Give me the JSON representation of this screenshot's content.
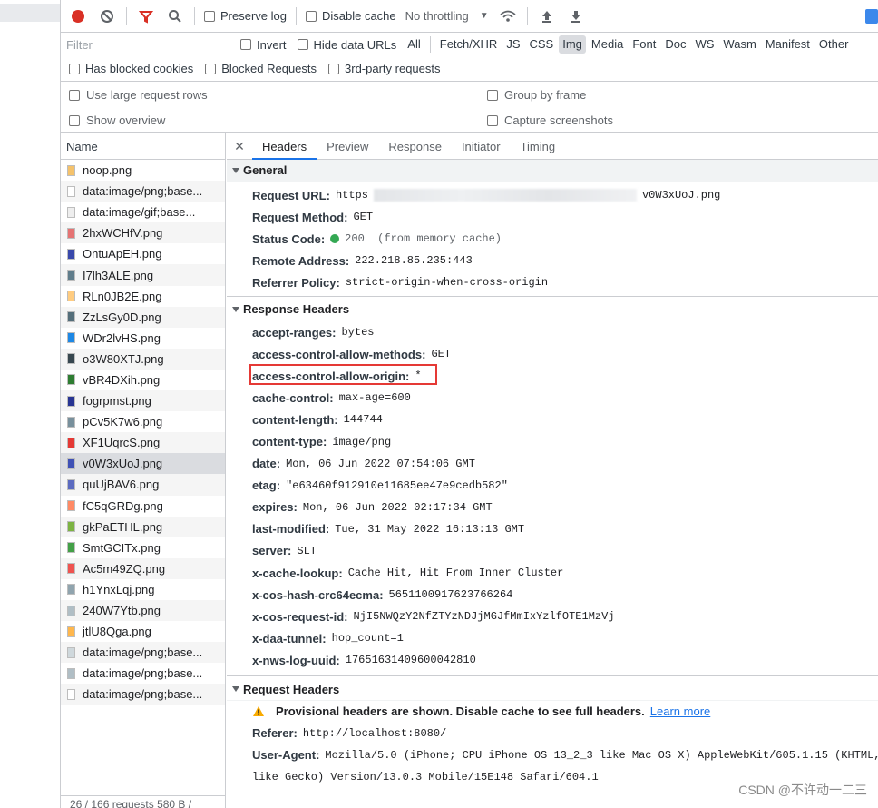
{
  "toolbar": {
    "preserve_log": "Preserve log",
    "disable_cache": "Disable cache",
    "throttling": "No throttling"
  },
  "filter": {
    "placeholder": "Filter",
    "invert": "Invert",
    "hide_data_urls": "Hide data URLs",
    "types": [
      "All",
      "Fetch/XHR",
      "JS",
      "CSS",
      "Img",
      "Media",
      "Font",
      "Doc",
      "WS",
      "Wasm",
      "Manifest",
      "Other"
    ],
    "active_type": "Img",
    "has_blocked_cookies": "Has blocked cookies",
    "blocked_requests": "Blocked Requests",
    "third_party": "3rd-party requests"
  },
  "settings": {
    "large_rows": "Use large request rows",
    "group_by_frame": "Group by frame",
    "show_overview": "Show overview",
    "capture_screenshots": "Capture screenshots"
  },
  "request_list": {
    "header": "Name",
    "items": [
      {
        "name": "noop.png",
        "color": "#f5c26b"
      },
      {
        "name": "data:image/png;base...",
        "color": "#ffffff"
      },
      {
        "name": "data:image/gif;base...",
        "color": "#eeeeee"
      },
      {
        "name": "2hxWCHfV.png",
        "color": "#e57373"
      },
      {
        "name": "OntuApEH.png",
        "color": "#3949ab"
      },
      {
        "name": "I7lh3ALE.png",
        "color": "#607d8b"
      },
      {
        "name": "RLn0JB2E.png",
        "color": "#ffcc80"
      },
      {
        "name": "ZzLsGy0D.png",
        "color": "#546e7a"
      },
      {
        "name": "WDr2lvHS.png",
        "color": "#1e88e5"
      },
      {
        "name": "o3W80XTJ.png",
        "color": "#37474f"
      },
      {
        "name": "vBR4DXih.png",
        "color": "#2e7d32"
      },
      {
        "name": "fogrpmst.png",
        "color": "#283593"
      },
      {
        "name": "pCv5K7w6.png",
        "color": "#78909c"
      },
      {
        "name": "XF1UqrcS.png",
        "color": "#e53935"
      },
      {
        "name": "v0W3xUoJ.png",
        "color": "#3f51b5"
      },
      {
        "name": "quUjBAV6.png",
        "color": "#5c6bc0"
      },
      {
        "name": "fC5qGRDg.png",
        "color": "#ff8a65"
      },
      {
        "name": "gkPaETHL.png",
        "color": "#7cb342"
      },
      {
        "name": "SmtGCITx.png",
        "color": "#43a047"
      },
      {
        "name": "Ac5m49ZQ.png",
        "color": "#ef5350"
      },
      {
        "name": "h1YnxLqj.png",
        "color": "#90a4ae"
      },
      {
        "name": "240W7Ytb.png",
        "color": "#b0bec5"
      },
      {
        "name": "jtlU8Qga.png",
        "color": "#ffb74d"
      },
      {
        "name": "data:image/png;base...",
        "color": "#cfd8dc"
      },
      {
        "name": "data:image/png;base...",
        "color": "#b0bec5"
      },
      {
        "name": "data:image/png;base...",
        "color": "#ffffff"
      }
    ],
    "selected_index": 14,
    "footer": "26 / 166 requests    580 B /"
  },
  "tabs": [
    "Headers",
    "Preview",
    "Response",
    "Initiator",
    "Timing"
  ],
  "general": {
    "title": "General",
    "rows": [
      {
        "name": "Request URL:",
        "value": "https",
        "value_end": "v0W3xUoJ.png"
      },
      {
        "name": "Request Method:",
        "value": "GET"
      },
      {
        "name": "Status Code:",
        "value": "200  (from memory cache)"
      },
      {
        "name": "Remote Address:",
        "value": "222.218.85.235:443"
      },
      {
        "name": "Referrer Policy:",
        "value": "strict-origin-when-cross-origin"
      }
    ]
  },
  "response_headers": {
    "title": "Response Headers",
    "rows": [
      {
        "name": "accept-ranges:",
        "value": "bytes"
      },
      {
        "name": "access-control-allow-methods:",
        "value": "GET"
      },
      {
        "name": "access-control-allow-origin:",
        "value": "*"
      },
      {
        "name": "cache-control:",
        "value": "max-age=600"
      },
      {
        "name": "content-length:",
        "value": "144744"
      },
      {
        "name": "content-type:",
        "value": "image/png"
      },
      {
        "name": "date:",
        "value": "Mon, 06 Jun 2022 07:54:06 GMT"
      },
      {
        "name": "etag:",
        "value": "\"e63460f912910e11685ee47e9cedb582\""
      },
      {
        "name": "expires:",
        "value": "Mon, 06 Jun 2022 02:17:34 GMT"
      },
      {
        "name": "last-modified:",
        "value": "Tue, 31 May 2022 16:13:13 GMT"
      },
      {
        "name": "server:",
        "value": "SLT"
      },
      {
        "name": "x-cache-lookup:",
        "value": "Cache Hit, Hit From Inner Cluster"
      },
      {
        "name": "x-cos-hash-crc64ecma:",
        "value": "5651100917623766264"
      },
      {
        "name": "x-cos-request-id:",
        "value": "NjI5NWQzY2NfZTYzNDJjMGJfMmIxYzlfOTE1MzVj"
      },
      {
        "name": "x-daa-tunnel:",
        "value": "hop_count=1"
      },
      {
        "name": "x-nws-log-uuid:",
        "value": "17651631409600042810"
      }
    ]
  },
  "request_headers": {
    "title": "Request Headers",
    "provisional": "Provisional headers are shown. Disable cache to see full headers.",
    "learn_more": "Learn more",
    "referer_name": "Referer:",
    "referer_value": "http://localhost:8080/",
    "ua_name": "User-Agent:",
    "ua_value_1": "Mozilla/5.0 (iPhone; CPU iPhone OS 13_2_3 like Mac OS X) AppleWebKit/605.1.15 (KHTML,",
    "ua_value_2": "like Gecko) Version/13.0.3 Mobile/15E148 Safari/604.1"
  },
  "watermark": "CSDN @不许动一二三",
  "colors": {
    "accent": "#1a73e8",
    "record_red": "#d93025",
    "highlight_box": "#e53935",
    "status_green": "#34a853"
  }
}
